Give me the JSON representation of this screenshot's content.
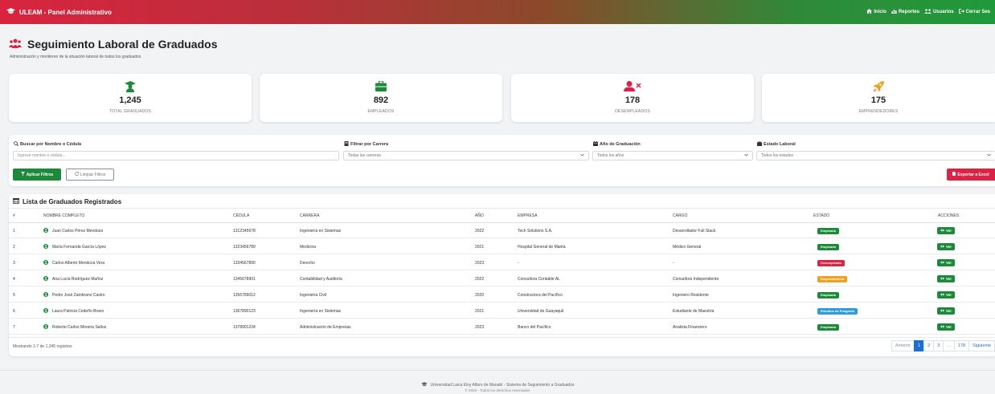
{
  "navbar": {
    "brand": "ULEAM - Panel Administrativo",
    "links": [
      {
        "label": "Inicio",
        "icon": "home-icon"
      },
      {
        "label": "Reportes",
        "icon": "chart-icon"
      },
      {
        "label": "Usuarios",
        "icon": "users-icon"
      },
      {
        "label": "Cerrar Ses",
        "icon": "logout-icon"
      }
    ]
  },
  "header": {
    "title": "Seguimiento Laboral de Graduados",
    "subtitle": "Administración y monitoreo de la situación laboral de todos los graduados"
  },
  "stats": [
    {
      "value": "1,245",
      "label": "TOTAL GRADUADOS",
      "color": "#1d8a3a",
      "icon": "graduate-icon"
    },
    {
      "value": "892",
      "label": "EMPLEADOS",
      "color": "#1d8a3a",
      "icon": "briefcase-icon"
    },
    {
      "value": "178",
      "label": "DESEMPLEADOS",
      "color": "#dc2345",
      "icon": "user-times-icon"
    },
    {
      "value": "175",
      "label": "EMPRENDEDORES",
      "color": "#f0a020",
      "icon": "rocket-icon"
    }
  ],
  "filters": {
    "search": {
      "label": "Buscar por Nombre o Cédula",
      "placeholder": "Ingrese nombre o cédula..."
    },
    "career": {
      "label": "Filtrar por Carrera",
      "value": "Todas las carreras"
    },
    "year": {
      "label": "Año de Graduación",
      "value": "Todos los años"
    },
    "status": {
      "label": "Estado Laboral",
      "value": "Todos los estados"
    },
    "apply_label": "Aplicar Filtros",
    "clear_label": "Limpiar Filtros",
    "export_label": "Exportar a Excel"
  },
  "table": {
    "title": "Lista de Graduados Registrados",
    "columns": [
      "#",
      "NOMBRE COMPLETO",
      "CÉDULA",
      "CARRERA",
      "AÑO",
      "EMPRESA",
      "CARGO",
      "ESTADO",
      "ACCIONES"
    ],
    "view_label": "Ver",
    "rows": [
      {
        "n": "1",
        "name": "Juan Carlos Pérez Mendoza",
        "id": "1312345678",
        "career": "Ingeniería en Sistemas",
        "year": "2022",
        "company": "Tech Solutions S.A.",
        "role": "Desarrollador Full Stack",
        "status": "Empleado",
        "status_color": "#1d8a3a"
      },
      {
        "n": "2",
        "name": "María Fernanda García López",
        "id": "1323456789",
        "career": "Medicina",
        "year": "2021",
        "company": "Hospital General de Manta",
        "role": "Médico General",
        "status": "Empleado",
        "status_color": "#1d8a3a"
      },
      {
        "n": "3",
        "name": "Carlos Alberto Mendoza Vera",
        "id": "1334567890",
        "career": "Derecho",
        "year": "2023",
        "company": "-",
        "role": "-",
        "status": "Desempleado",
        "status_color": "#dc2345"
      },
      {
        "n": "4",
        "name": "Ana Lucía Rodríguez Muñoz",
        "id": "1345678901",
        "career": "Contabilidad y Auditoría",
        "year": "2022",
        "company": "Consultora Contable AL",
        "role": "Consultora Independiente",
        "status": "Emprendedor/a",
        "status_color": "#f0a020"
      },
      {
        "n": "5",
        "name": "Pedro José Zambrano Castro",
        "id": "1356789012",
        "career": "Ingeniería Civil",
        "year": "2020",
        "company": "Constructora del Pacífico",
        "role": "Ingeniero Residente",
        "status": "Empleado",
        "status_color": "#1d8a3a"
      },
      {
        "n": "6",
        "name": "Laura Patricia Cedeño Bravo",
        "id": "1367890123",
        "career": "Ingeniería en Sistemas",
        "year": "2021",
        "company": "Universidad de Guayaquil",
        "role": "Estudiante de Maestría",
        "status": "Estudios de Posgrado",
        "status_color": "#2e9be0"
      },
      {
        "n": "7",
        "name": "Roberto Carlos Moreira Saltos",
        "id": "1378901234",
        "career": "Administración de Empresas",
        "year": "2023",
        "company": "Banco del Pacífico",
        "role": "Analista Financiero",
        "status": "Empleado",
        "status_color": "#1d8a3a"
      }
    ],
    "showing": "Mostrando 1-7 de 1,245 registros",
    "pagination": [
      "Anterior",
      "1",
      "2",
      "3",
      "...",
      "178",
      "Siguiente"
    ]
  },
  "footer": {
    "line1": "Universidad Laica Eloy Alfaro de Manabí - Sistema de Seguimiento a Graduados",
    "line2": "© 2025 - Todos los derechos reservados"
  }
}
